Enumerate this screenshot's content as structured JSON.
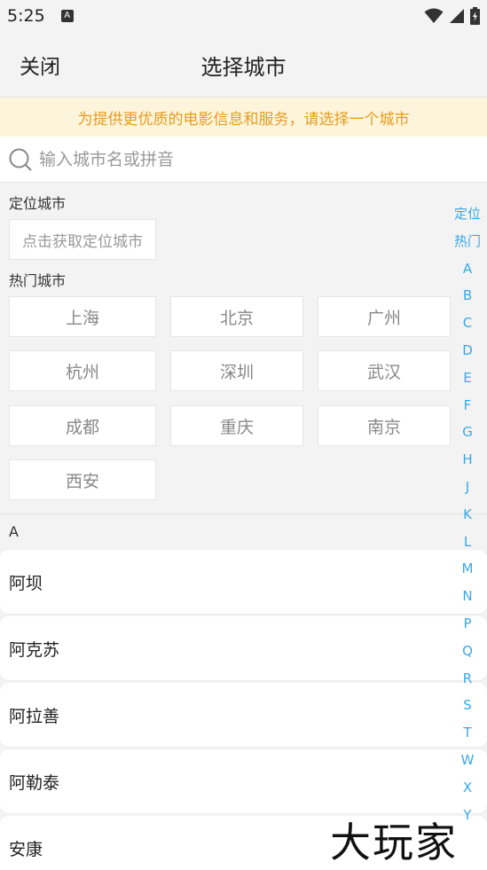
{
  "status_bar": {
    "time": "5:25",
    "notification_glyph": "A"
  },
  "header": {
    "close_label": "关闭",
    "title": "选择城市"
  },
  "notice": "为提供更优质的电影信息和服务，请选择一个城市",
  "search": {
    "placeholder": "输入城市名或拼音"
  },
  "location": {
    "label": "定位城市",
    "button": "点击获取定位城市"
  },
  "hot": {
    "label": "热门城市",
    "cities": [
      "上海",
      "北京",
      "广州",
      "杭州",
      "深圳",
      "武汉",
      "成都",
      "重庆",
      "南京",
      "西安"
    ]
  },
  "group": {
    "letter": "A",
    "cities": [
      "阿坝",
      "阿克苏",
      "阿拉善",
      "阿勒泰",
      "安康"
    ]
  },
  "index_bar": [
    "定位",
    "热门",
    "A",
    "B",
    "C",
    "D",
    "E",
    "F",
    "G",
    "H",
    "J",
    "K",
    "L",
    "M",
    "N",
    "P",
    "Q",
    "R",
    "S",
    "T",
    "W",
    "X",
    "Y"
  ],
  "watermark": "大玩家",
  "colors": {
    "accent": "#3aa8e6",
    "notice_text": "#e89c1e",
    "notice_bg": "#fdf4dc"
  }
}
